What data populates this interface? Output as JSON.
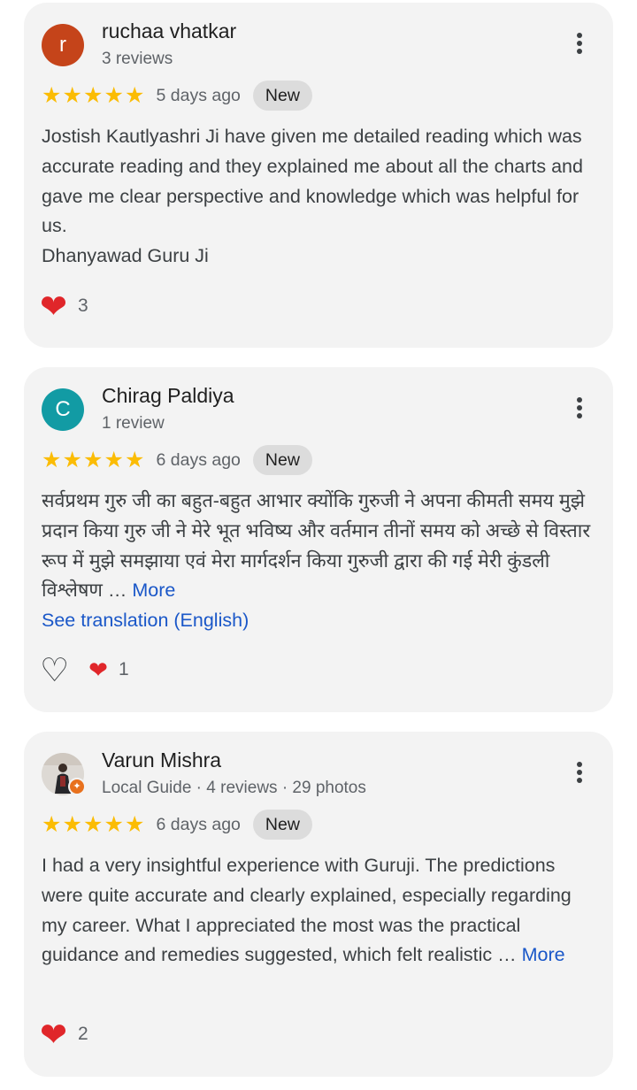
{
  "reviews": [
    {
      "avatar_letter": "r",
      "avatar_color": "#c5441a",
      "name": "ruchaa vhatkar",
      "meta": "3 reviews",
      "rating": 5,
      "time": "5 days ago",
      "badge": "New",
      "text_lines": [
        "Jostish Kautlyashri Ji have given me detailed reading which was accurate reading and they explained me about all the charts and gave me clear perspective and knowledge which was helpful for us.",
        "Dhanyawad Guru Ji"
      ],
      "likes": "3"
    },
    {
      "avatar_letter": "C",
      "avatar_color": "#129ba4",
      "name": "Chirag Paldiya",
      "meta": "1 review",
      "rating": 5,
      "time": "6 days ago",
      "badge": "New",
      "text": "सर्वप्रथम गुरु जी का बहुत-बहुत आभार क्योंकि गुरुजी ने अपना कीमती समय मुझे प्रदान किया गुरु जी ने मेरे भूत भविष्य और वर्तमान तीनों समय को अच्छे से विस्तार रूप में मुझे समझाया एवं मेरा मार्गदर्शन किया गुरुजी द्वारा की गई मेरी कुंडली विश्लेषण …",
      "more_label": "More",
      "translate_label": "See translation (English)",
      "likes": "1"
    },
    {
      "name": "Varun Mishra",
      "meta": "Local Guide · 4 reviews · 29 photos",
      "rating": 5,
      "time": "6 days ago",
      "badge": "New",
      "text": "I had a very insightful experience with Guruji. The predictions were quite accurate and clearly explained, especially regarding my career. What I appreciated the most was the practical guidance and remedies suggested, which felt realistic …",
      "more_label": "More",
      "likes": "2"
    }
  ],
  "colors": {
    "star": "#fbbc04",
    "heart": "#e0262a",
    "link": "#1a57c8",
    "card_bg": "#f3f3f3"
  },
  "icons": {
    "star": "star-icon",
    "heart": "heart-icon",
    "menu": "more-vert-icon"
  }
}
